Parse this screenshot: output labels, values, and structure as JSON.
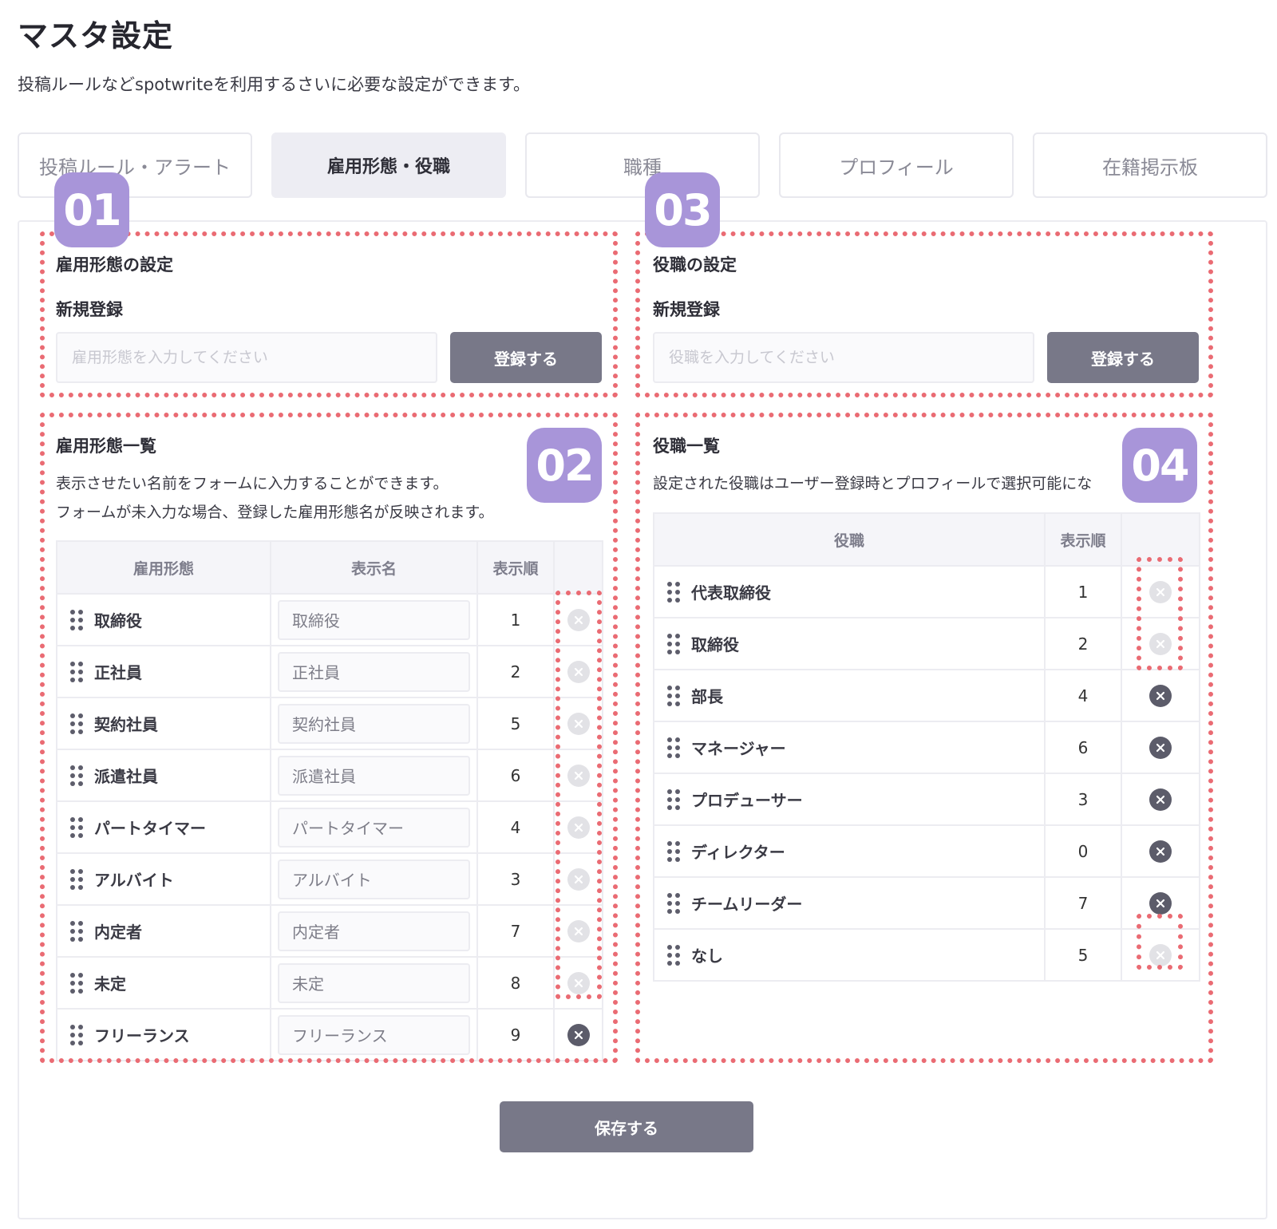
{
  "page": {
    "title": "マスタ設定",
    "description": "投稿ルールなどspotwriteを利用するさいに必要な設定ができます。"
  },
  "tabs": [
    {
      "label": "投稿ルール・アラート",
      "active": false
    },
    {
      "label": "雇用形態・役職",
      "active": true
    },
    {
      "label": "職種",
      "active": false
    },
    {
      "label": "プロフィール",
      "active": false
    },
    {
      "label": "在籍掲示板",
      "active": false
    }
  ],
  "badges": [
    "01",
    "02",
    "03",
    "04"
  ],
  "employment": {
    "settings_title": "雇用形態の設定",
    "new_label": "新規登録",
    "input_placeholder": "雇用形態を入力してください",
    "register_button": "登録する",
    "list_title": "雇用形態一覧",
    "list_desc_1": "表示させたい名前をフォームに入力することができます。",
    "list_desc_2": "フォームが未入力な場合、登録した雇用形態名が反映されます。",
    "columns": [
      "雇用形態",
      "表示名",
      "表示順"
    ],
    "rows": [
      {
        "name": "取締役",
        "display": "取締役",
        "order": "1",
        "deletable": false
      },
      {
        "name": "正社員",
        "display": "正社員",
        "order": "2",
        "deletable": false
      },
      {
        "name": "契約社員",
        "display": "契約社員",
        "order": "5",
        "deletable": false
      },
      {
        "name": "派遣社員",
        "display": "派遣社員",
        "order": "6",
        "deletable": false
      },
      {
        "name": "パートタイマー",
        "display": "パートタイマー",
        "order": "4",
        "deletable": false
      },
      {
        "name": "アルバイト",
        "display": "アルバイト",
        "order": "3",
        "deletable": false
      },
      {
        "name": "内定者",
        "display": "内定者",
        "order": "7",
        "deletable": false
      },
      {
        "name": "未定",
        "display": "未定",
        "order": "8",
        "deletable": false
      },
      {
        "name": "フリーランス",
        "display": "フリーランス",
        "order": "9",
        "deletable": true
      }
    ]
  },
  "position": {
    "settings_title": "役職の設定",
    "new_label": "新規登録",
    "input_placeholder": "役職を入力してください",
    "register_button": "登録する",
    "list_title": "役職一覧",
    "list_desc": "設定された役職はユーザー登録時とプロフィールで選択可能にな",
    "columns": [
      "役職",
      "表示順"
    ],
    "rows": [
      {
        "name": "代表取締役",
        "order": "1",
        "deletable": false
      },
      {
        "name": "取締役",
        "order": "2",
        "deletable": false
      },
      {
        "name": "部長",
        "order": "4",
        "deletable": true
      },
      {
        "name": "マネージャー",
        "order": "6",
        "deletable": true
      },
      {
        "name": "プロデューサー",
        "order": "3",
        "deletable": true
      },
      {
        "name": "ディレクター",
        "order": "0",
        "deletable": true
      },
      {
        "name": "チームリーダー",
        "order": "7",
        "deletable": true
      },
      {
        "name": "なし",
        "order": "5",
        "deletable": false
      }
    ]
  },
  "save_button": "保存する",
  "colors": {
    "accent_badge": "#a895d9",
    "annotation": "#ea6b73",
    "button": "#787888"
  }
}
